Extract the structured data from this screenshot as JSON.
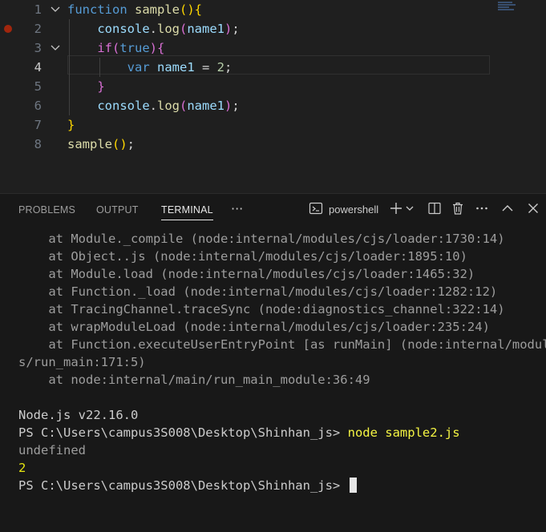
{
  "editor": {
    "lines": [
      {
        "num": "1",
        "tokens": [
          {
            "t": "function",
            "c": "kw"
          },
          {
            "t": " ",
            "c": "plain"
          },
          {
            "t": "sample",
            "c": "fn"
          },
          {
            "t": "()",
            "c": "b1"
          },
          {
            "t": "{",
            "c": "b1"
          }
        ]
      },
      {
        "num": "2",
        "tokens": [
          {
            "t": "    ",
            "c": "plain"
          },
          {
            "t": "console",
            "c": "var"
          },
          {
            "t": ".",
            "c": "plain"
          },
          {
            "t": "log",
            "c": "fn"
          },
          {
            "t": "(",
            "c": "b2"
          },
          {
            "t": "name1",
            "c": "var"
          },
          {
            "t": ")",
            "c": "b2"
          },
          {
            "t": ";",
            "c": "plain"
          }
        ]
      },
      {
        "num": "3",
        "tokens": [
          {
            "t": "    ",
            "c": "plain"
          },
          {
            "t": "if",
            "c": "b2"
          },
          {
            "t": "(",
            "c": "b2"
          },
          {
            "t": "true",
            "c": "kw"
          },
          {
            "t": ")",
            "c": "b2"
          },
          {
            "t": "{",
            "c": "b2"
          }
        ]
      },
      {
        "num": "4",
        "tokens": [
          {
            "t": "        ",
            "c": "plain"
          },
          {
            "t": "var",
            "c": "kw"
          },
          {
            "t": " ",
            "c": "plain"
          },
          {
            "t": "name1",
            "c": "var"
          },
          {
            "t": " = ",
            "c": "plain"
          },
          {
            "t": "2",
            "c": "num"
          },
          {
            "t": ";",
            "c": "plain"
          }
        ]
      },
      {
        "num": "5",
        "tokens": [
          {
            "t": "    ",
            "c": "plain"
          },
          {
            "t": "}",
            "c": "b2"
          }
        ]
      },
      {
        "num": "6",
        "tokens": [
          {
            "t": "    ",
            "c": "plain"
          },
          {
            "t": "console",
            "c": "var"
          },
          {
            "t": ".",
            "c": "plain"
          },
          {
            "t": "log",
            "c": "fn"
          },
          {
            "t": "(",
            "c": "b2"
          },
          {
            "t": "name1",
            "c": "var"
          },
          {
            "t": ")",
            "c": "b2"
          },
          {
            "t": ";",
            "c": "plain"
          }
        ]
      },
      {
        "num": "7",
        "tokens": [
          {
            "t": "}",
            "c": "b1"
          }
        ]
      },
      {
        "num": "8",
        "tokens": [
          {
            "t": "sample",
            "c": "fn"
          },
          {
            "t": "()",
            "c": "b1"
          },
          {
            "t": ";",
            "c": "plain"
          }
        ]
      }
    ],
    "active_line": "4",
    "breakpoint_line": "2",
    "foldable_lines": [
      "1",
      "3"
    ]
  },
  "panel": {
    "tabs": [
      "PROBLEMS",
      "OUTPUT",
      "TERMINAL"
    ],
    "active_tab": "TERMINAL",
    "more": "···",
    "shell_label": "powershell"
  },
  "terminal": {
    "lines": [
      {
        "text": "    at Module._compile (node:internal/modules/cjs/loader:1730:14)",
        "style": "t-dim"
      },
      {
        "text": "    at Object..js (node:internal/modules/cjs/loader:1895:10)",
        "style": "t-dim"
      },
      {
        "text": "    at Module.load (node:internal/modules/cjs/loader:1465:32)",
        "style": "t-dim"
      },
      {
        "text": "    at Function._load (node:internal/modules/cjs/loader:1282:12)",
        "style": "t-dim"
      },
      {
        "text": "    at TracingChannel.traceSync (node:diagnostics_channel:322:14)",
        "style": "t-dim"
      },
      {
        "text": "    at wrapModuleLoad (node:internal/modules/cjs/loader:235:24)",
        "style": "t-dim"
      },
      {
        "text": "    at Function.executeUserEntryPoint [as runMain] (node:internal/module",
        "style": "t-dim"
      },
      {
        "text": "s/run_main:171:5)",
        "style": "t-dim"
      },
      {
        "text": "    at node:internal/main/run_main_module:36:49",
        "style": "t-dim"
      },
      {
        "text": "",
        "style": "t-dim"
      },
      {
        "text": "Node.js v22.16.0",
        "style": ""
      },
      {
        "text": "PS C:\\Users\\campus3S008\\Desktop\\Shinhan_js> ",
        "style": "",
        "cmd": "node sample2.js"
      },
      {
        "text": "undefined",
        "style": "t-dim"
      },
      {
        "text": "2",
        "style": "t-num2"
      },
      {
        "text": "PS C:\\Users\\campus3S008\\Desktop\\Shinhan_js> ",
        "style": "",
        "cursor": true
      }
    ]
  },
  "colors": {
    "editor_bg": "#1f1f1f",
    "panel_bg": "#181818",
    "keyword": "#569cd6",
    "function": "#dcdcaa",
    "variable": "#9cdcfe",
    "number": "#b5cea8",
    "bracket_gold": "#ffd700",
    "bracket_purple": "#da70d6",
    "breakpoint": "#a1260d",
    "command_yellow": "#f5f543"
  },
  "icons": {
    "fold": "chevron-down-icon",
    "shell": "terminal-icon",
    "add": "plus-icon",
    "add_dropdown": "chevron-down-icon",
    "split": "split-editor-icon",
    "trash": "trash-icon",
    "more": "ellipsis-icon",
    "maximize": "chevron-up-icon",
    "close": "close-icon"
  }
}
